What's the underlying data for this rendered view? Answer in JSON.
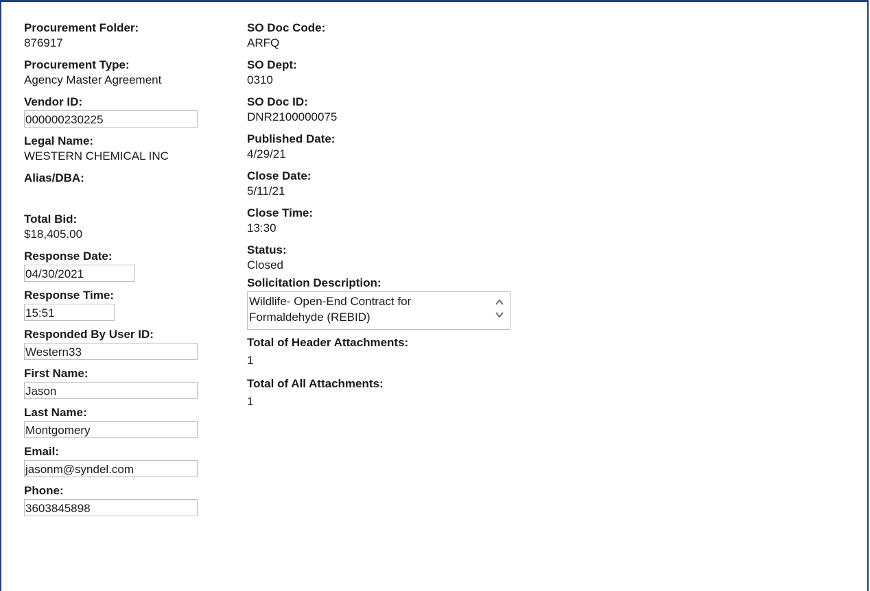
{
  "left": {
    "procurement_folder": {
      "label": "Procurement Folder:",
      "value": "876917"
    },
    "procurement_type": {
      "label": "Procurement Type:",
      "value": "Agency Master Agreement"
    },
    "vendor_id": {
      "label": "Vendor ID:",
      "value": "000000230225"
    },
    "legal_name": {
      "label": "Legal Name:",
      "value": "WESTERN CHEMICAL INC"
    },
    "alias_dba": {
      "label": "Alias/DBA:",
      "value": ""
    },
    "total_bid": {
      "label": "Total Bid:",
      "value": "$18,405.00"
    },
    "response_date": {
      "label": "Response Date:",
      "value": "04/30/2021"
    },
    "response_time": {
      "label": "Response Time:",
      "value": "15:51"
    },
    "responded_by": {
      "label": "Responded By User ID:",
      "value": "Western33"
    },
    "first_name": {
      "label": "First Name:",
      "value": "Jason"
    },
    "last_name": {
      "label": "Last Name:",
      "value": "Montgomery"
    },
    "email": {
      "label": "Email:",
      "value": "jasonm@syndel.com"
    },
    "phone": {
      "label": "Phone:",
      "value": "3603845898"
    }
  },
  "right": {
    "so_doc_code": {
      "label": "SO Doc Code:",
      "value": "ARFQ"
    },
    "so_dept": {
      "label": "SO Dept:",
      "value": "0310"
    },
    "so_doc_id": {
      "label": "SO Doc ID:",
      "value": "DNR2100000075"
    },
    "published_date": {
      "label": "Published Date:",
      "value": "4/29/21"
    },
    "close_date": {
      "label": "Close Date:",
      "value": "5/11/21"
    },
    "close_time": {
      "label": "Close Time:",
      "value": "13:30"
    },
    "status": {
      "label": "Status:",
      "value": "Closed"
    },
    "solicitation_description": {
      "label": "Solicitation Description:",
      "value": "Wildlife- Open-End Contract for\nFormaldehyde (REBID)"
    },
    "header_attachments": {
      "label": "Total of Header Attachments:",
      "value": "1"
    },
    "all_attachments": {
      "label": "Total of All Attachments:",
      "value": "1"
    }
  },
  "colors": {
    "frame_border": "#1f3f7a",
    "field_border": "#bdbdbd",
    "text": "#1a1a1a"
  },
  "icons": [
    "chevron-up-icon",
    "chevron-down-icon"
  ]
}
